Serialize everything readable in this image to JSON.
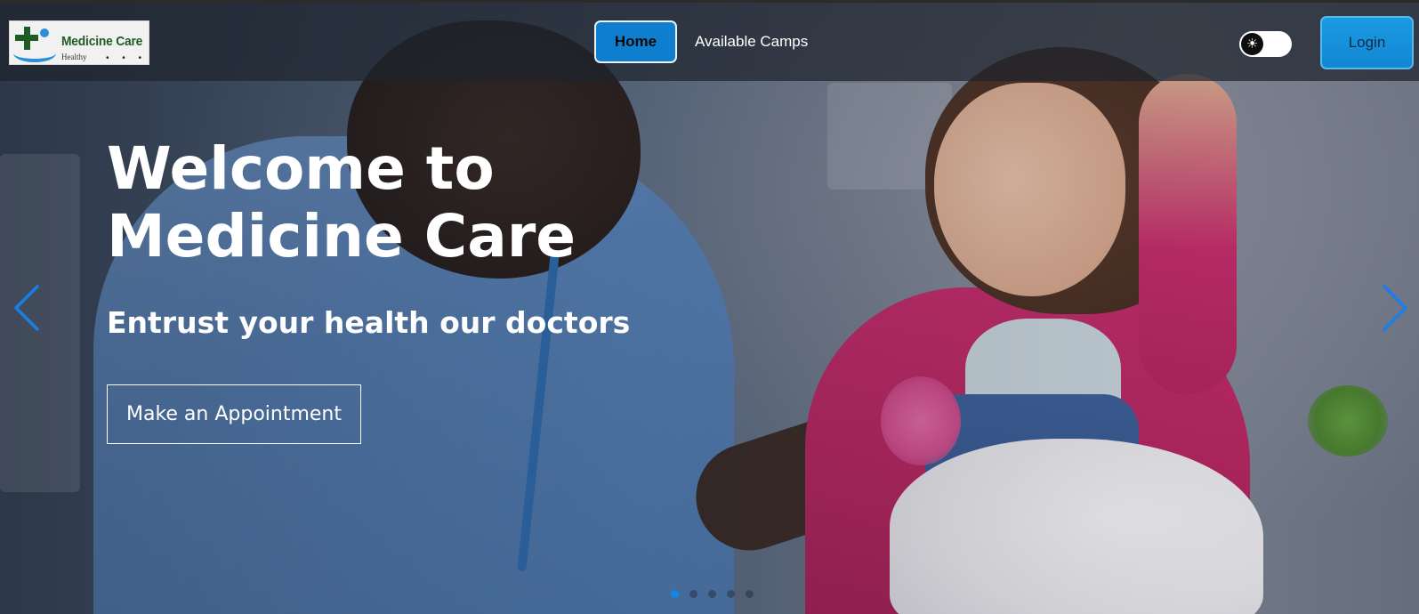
{
  "brand": {
    "title": "Medicine Care",
    "tagline": "Healthy",
    "dots": "• • •"
  },
  "nav": {
    "home_label": "Home",
    "camps_label": "Available Camps",
    "login_label": "Login",
    "theme_icon": "sun-icon"
  },
  "hero": {
    "title_line1": "Welcome to",
    "title_line2": "Medicine Care",
    "subtitle": "Entrust your health our doctors",
    "cta_label": "Make an Appointment"
  },
  "carousel": {
    "slide_count": 5,
    "active_index": 0
  },
  "colors": {
    "accent": "#1287d4",
    "nav_bg": "#1e242e",
    "arrow": "#1b7ee8"
  }
}
